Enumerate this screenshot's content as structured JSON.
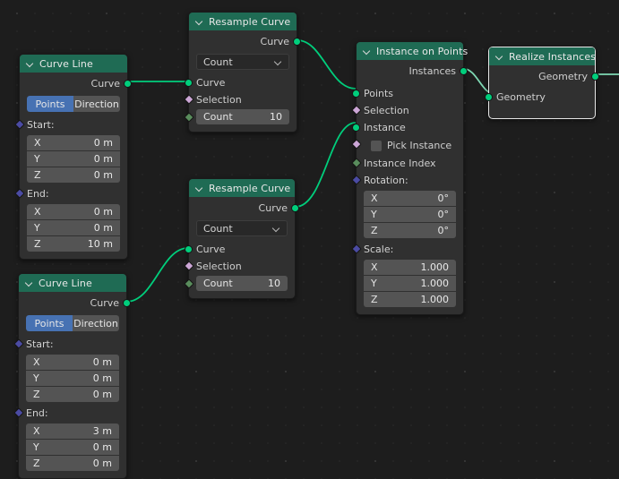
{
  "app": {
    "editor": "Geometry Node Editor",
    "background": "#1d1d1d"
  },
  "colors": {
    "header_green": "#1f6b54",
    "geometry_socket": "#00ce7c",
    "boolean_socket": "#cca6d6",
    "integer_socket": "#598c5c",
    "rotation_socket": "#4b4ba3",
    "toggle_active": "#4772b3",
    "field_gray": "#545454",
    "node_body": "#303030",
    "active_outline": "#e6e6e6"
  },
  "nodes": [
    {
      "id": "curve-line-1",
      "title": "Curve Line",
      "outputs": [
        {
          "label": "Curve",
          "type": "geometry"
        }
      ],
      "mode": {
        "options": [
          "Points",
          "Direction"
        ],
        "selected": "Points"
      },
      "sections": [
        {
          "label": "Start:",
          "socket": "rotation",
          "fields": [
            {
              "label": "X",
              "value": "0 m"
            },
            {
              "label": "Y",
              "value": "0 m"
            },
            {
              "label": "Z",
              "value": "0 m"
            }
          ]
        },
        {
          "label": "End:",
          "socket": "rotation",
          "fields": [
            {
              "label": "X",
              "value": "0 m"
            },
            {
              "label": "Y",
              "value": "0 m"
            },
            {
              "label": "Z",
              "value": "10 m"
            }
          ]
        }
      ]
    },
    {
      "id": "curve-line-2",
      "title": "Curve Line",
      "outputs": [
        {
          "label": "Curve",
          "type": "geometry"
        }
      ],
      "mode": {
        "options": [
          "Points",
          "Direction"
        ],
        "selected": "Points"
      },
      "sections": [
        {
          "label": "Start:",
          "socket": "rotation",
          "fields": [
            {
              "label": "X",
              "value": "0 m"
            },
            {
              "label": "Y",
              "value": "0 m"
            },
            {
              "label": "Z",
              "value": "0 m"
            }
          ]
        },
        {
          "label": "End:",
          "socket": "rotation",
          "fields": [
            {
              "label": "X",
              "value": "3 m"
            },
            {
              "label": "Y",
              "value": "0 m"
            },
            {
              "label": "Z",
              "value": "0 m"
            }
          ]
        }
      ]
    },
    {
      "id": "resample-curve-1",
      "title": "Resample Curve",
      "outputs": [
        {
          "label": "Curve",
          "type": "geometry"
        }
      ],
      "dropdown": {
        "value": "Count",
        "icon": "chevron-down-icon"
      },
      "inputs": [
        {
          "label": "Curve",
          "type": "geometry"
        },
        {
          "label": "Selection",
          "type": "boolean"
        }
      ],
      "value_field": {
        "label": "Count",
        "value": "10",
        "type": "integer"
      }
    },
    {
      "id": "resample-curve-2",
      "title": "Resample Curve",
      "outputs": [
        {
          "label": "Curve",
          "type": "geometry"
        }
      ],
      "dropdown": {
        "value": "Count",
        "icon": "chevron-down-icon"
      },
      "inputs": [
        {
          "label": "Curve",
          "type": "geometry"
        },
        {
          "label": "Selection",
          "type": "boolean"
        }
      ],
      "value_field": {
        "label": "Count",
        "value": "10",
        "type": "integer"
      }
    },
    {
      "id": "instance-on-points",
      "title": "Instance on Points",
      "outputs": [
        {
          "label": "Instances",
          "type": "geometry"
        }
      ],
      "inputs": [
        {
          "label": "Points",
          "type": "geometry"
        },
        {
          "label": "Selection",
          "type": "boolean"
        },
        {
          "label": "Instance",
          "type": "geometry"
        },
        {
          "label": "Pick Instance",
          "type": "boolean",
          "checkbox": true,
          "checked": false
        },
        {
          "label": "Instance Index",
          "type": "integer"
        }
      ],
      "sections": [
        {
          "label": "Rotation:",
          "socket": "rotation",
          "fields": [
            {
              "label": "X",
              "value": "0°"
            },
            {
              "label": "Y",
              "value": "0°"
            },
            {
              "label": "Z",
              "value": "0°"
            }
          ]
        },
        {
          "label": "Scale:",
          "socket": "rotation",
          "fields": [
            {
              "label": "X",
              "value": "1.000"
            },
            {
              "label": "Y",
              "value": "1.000"
            },
            {
              "label": "Z",
              "value": "1.000"
            }
          ]
        }
      ]
    },
    {
      "id": "realize-instances",
      "title": "Realize Instances",
      "active": true,
      "outputs": [
        {
          "label": "Geometry",
          "type": "geometry"
        }
      ],
      "inputs": [
        {
          "label": "Geometry",
          "type": "geometry"
        }
      ]
    }
  ]
}
